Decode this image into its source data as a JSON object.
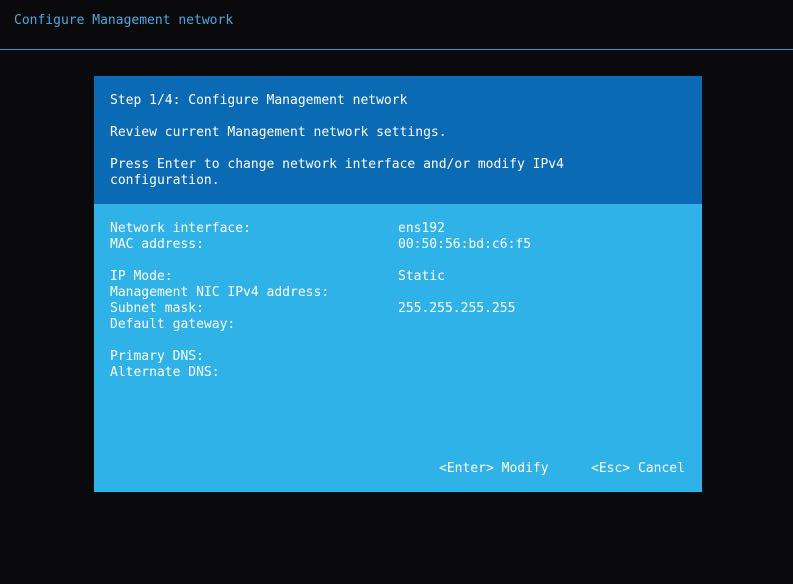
{
  "app": {
    "title": "Configure Management network"
  },
  "dialog": {
    "step_title": "Step 1/4: Configure Management network",
    "review_text": "Review current Management network settings.",
    "instruction_line1": "Press Enter to change network interface and/or modify IPv4",
    "instruction_line2": "configuration.",
    "fields": [
      {
        "label": "Network interface:",
        "value": "ens192"
      },
      {
        "label": "MAC address:",
        "value": "00:50:56:bd:c6:f5"
      },
      {
        "label": "IP Mode:",
        "value": "Static"
      },
      {
        "label": "Management NIC IPv4 address:",
        "value": ""
      },
      {
        "label": "Subnet mask:",
        "value": "255.255.255.255"
      },
      {
        "label": "Default gateway:",
        "value": ""
      },
      {
        "label": "Primary DNS:",
        "value": ""
      },
      {
        "label": "Alternate DNS:",
        "value": ""
      }
    ],
    "actions": {
      "modify_label": "<Enter> Modify",
      "cancel_label": "<Esc> Cancel"
    }
  },
  "colors": {
    "background": "#0a0a0c",
    "title_text": "#4aa8e0",
    "header_blue": "#0a6ab4",
    "body_blue": "#2eb2e8",
    "text": "#ffffff"
  }
}
